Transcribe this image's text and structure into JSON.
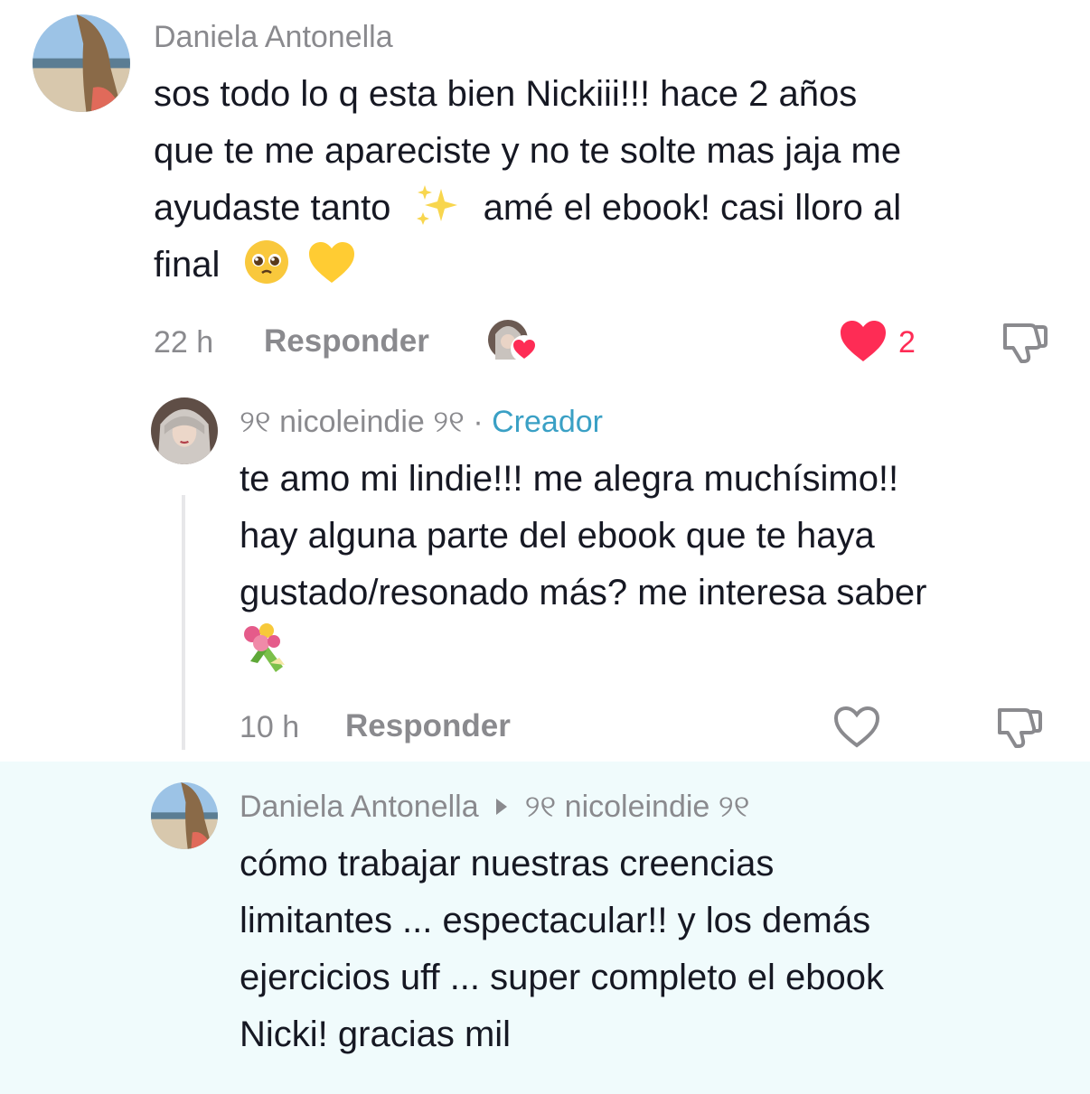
{
  "comments": [
    {
      "username": "Daniela Antonella",
      "text_line1": "sos todo lo q esta bien Nickiii!!! hace 2 años",
      "text_line2": "que te me apareciste y no te solte mas jaja me",
      "text_line3a": "ayudaste tanto",
      "text_line3b": "amé el ebook! casi lloro al",
      "text_line4": "final",
      "time": "22 h",
      "reply_label": "Responder",
      "like_count": "2",
      "creator_liked": true
    },
    {
      "username": "nicoleindie",
      "username_prefix": "୨୧",
      "username_suffix": "୨୧",
      "separator": "·",
      "creator_label": "Creador",
      "text_line1": "te amo mi lindie!!! me alegra muchísimo!!",
      "text_line2": "hay alguna parte del ebook que te haya",
      "text_line3": "gustado/resonado más? me interesa saber",
      "time": "10 h",
      "reply_label": "Responder"
    },
    {
      "username": "Daniela Antonella",
      "reply_to_prefix": "୨୧",
      "reply_to": "nicoleindie",
      "reply_to_suffix": "୨୧",
      "text_line1": "cómo trabajar nuestras creencias",
      "text_line2": "limitantes ... espectacular!! y los demás",
      "text_line3": "ejercicios uff ... super completo el ebook",
      "text_line4": "Nicki! gracias mil"
    }
  ],
  "icons": {
    "sparkles": "sparkles-emoji",
    "pleading": "pleading-face-emoji",
    "heart_yellow": "yellow-heart-emoji",
    "bouquet": "bouquet-emoji",
    "like": "heart-icon",
    "dislike": "thumbs-down-icon",
    "reply_arrow": "play-arrow-icon"
  },
  "colors": {
    "like_red": "#fe2c55",
    "creator_blue": "#3aa0c5",
    "highlight_bg": "#f0fbfc"
  }
}
